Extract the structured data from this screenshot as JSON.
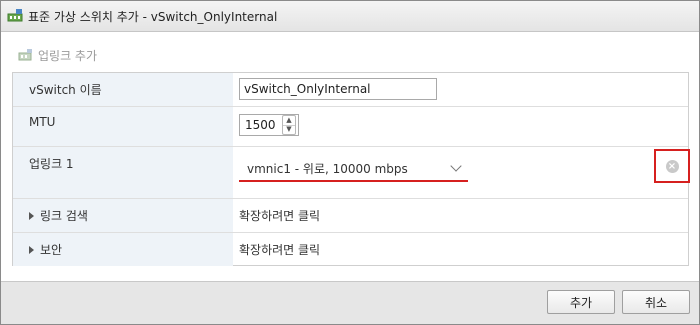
{
  "dialog": {
    "title": "표준 가상 스위치 추가 - vSwitch_OnlyInternal"
  },
  "toolbar": {
    "add_uplink_label": "업링크 추가"
  },
  "form": {
    "vswitch_name": {
      "label": "vSwitch 이름",
      "value": "vSwitch_OnlyInternal"
    },
    "mtu": {
      "label": "MTU",
      "value": "1500"
    },
    "uplink1": {
      "label": "업링크 1",
      "selected": "vmnic1 - 위로, 10000 mbps"
    },
    "link_discovery": {
      "label": "링크 검색",
      "value": "확장하려면 클릭"
    },
    "security": {
      "label": "보안",
      "value": "확장하려면 클릭"
    }
  },
  "buttons": {
    "add": "추가",
    "cancel": "취소"
  },
  "colors": {
    "highlight_red": "#d6201f",
    "label_bg": "#eef3f8"
  }
}
